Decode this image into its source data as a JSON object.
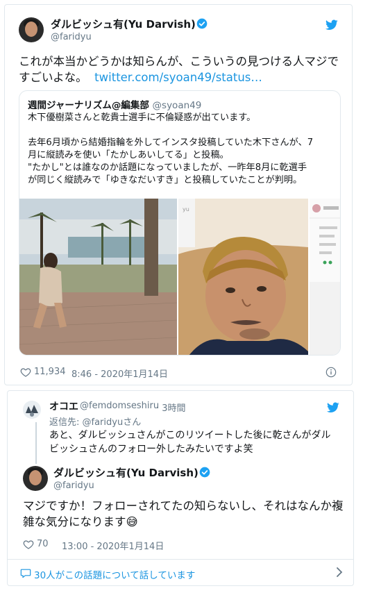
{
  "main_tweet": {
    "author_name": "ダルビッシュ有(Yu Darvish)",
    "author_handle": "@faridyu",
    "text_line1": "これが本当かどうかは知らんが、こういうの見つける人マジで",
    "text_line2": "すごいよな。",
    "link_text": "twitter.com/syoan49/status…",
    "likes": "11,934",
    "timestamp": "8:46 - 2020年1月14日",
    "quote": {
      "author_name": "週間ジャーナリズム@編集部",
      "author_handle": "@syoan49",
      "text": "木下優樹菜さんと乾貴士選手に不倫疑惑が出ています。\n\n去年6月頃から結婚指輪を外してインスタ投稿していた木下さんが、7\n月に縦読みを使い「たかしあいしてる」と投稿。\n\"たかし\"とは誰なのか話題になっていましたが、一昨年8月に乾選手\nが同じく縦読みで「ゆきなだいすき」と投稿していたことが判明。"
    }
  },
  "reply_card": {
    "reply_author_name": "オコエ",
    "reply_author_handle": "@femdomseshiru",
    "reply_time": "· 3時間",
    "reply_to": "返信先: @faridyuさん",
    "reply_line1": "あと、ダルビッシュさんがこのリツイートした後に乾さんがダル",
    "reply_line2": "ビッシュさんのフォロー外したみたいですよ笑",
    "author_name": "ダルビッシュ有(Yu Darvish)",
    "author_handle": "@faridyu",
    "text_line1": "マジですか！フォローされてたの知らないし、それはなんか複",
    "text_line2": "雑な気分になります😅",
    "likes": "70",
    "timestamp": "13:00 - 2020年1月14日",
    "footer": "30人がこの話題について話しています"
  },
  "colors": {
    "accent": "#1b95e0",
    "muted": "#657786",
    "border": "#e1e8ed"
  },
  "icons": [
    "verified-badge-icon",
    "twitter-bird-icon",
    "heart-icon",
    "info-icon",
    "comment-icon",
    "chevron-right-icon"
  ]
}
